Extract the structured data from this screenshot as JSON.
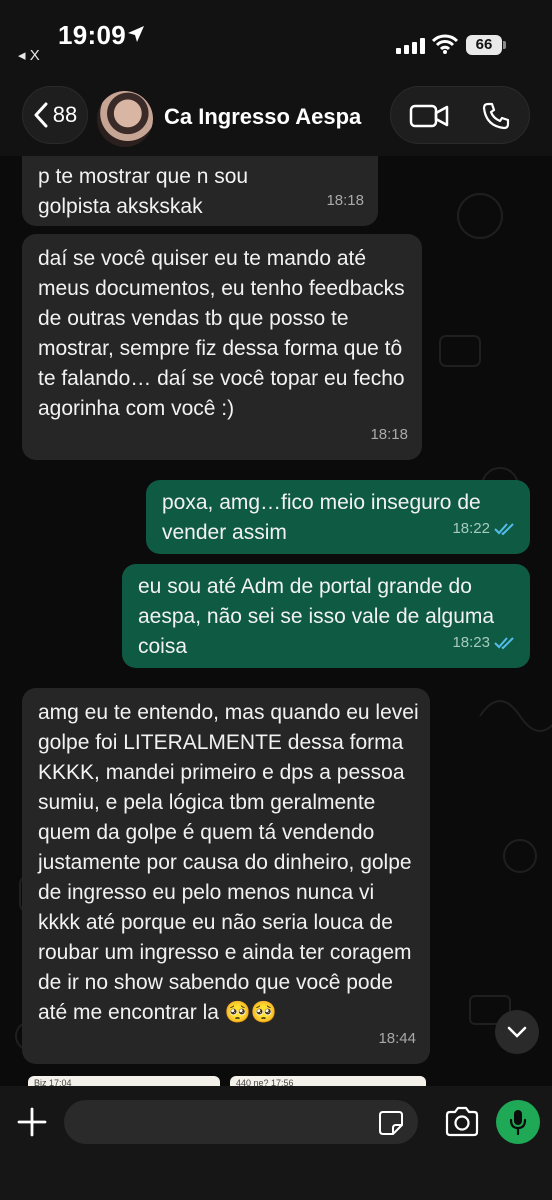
{
  "status_bar": {
    "time": "19:09",
    "back_app": "◂ X",
    "battery": "66"
  },
  "header": {
    "back_count": "88",
    "contact_name": "Ca Ingresso Aespa"
  },
  "messages": [
    {
      "direction": "in",
      "text": "p te mostrar que n sou golpista akskskak",
      "time": "18:18"
    },
    {
      "direction": "in",
      "text": "daí se você quiser eu te mando até meus documentos, eu tenho feedbacks de outras vendas tb que posso te mostrar, sempre fiz dessa forma que tô te falando… daí se você topar eu fecho agorinha com você :)",
      "time": "18:18"
    },
    {
      "direction": "out",
      "text": "poxa, amg…fico meio inseguro de vender assim",
      "time": "18:22"
    },
    {
      "direction": "out",
      "text": "eu sou até Adm de portal grande do aespa, não sei se isso vale de alguma coisa",
      "time": "18:23"
    },
    {
      "direction": "in",
      "text": "amg eu te entendo, mas quando eu levei golpe foi LITERALMENTE dessa forma KKKK, mandei primeiro e dps a pessoa sumiu, e pela lógica tbm geralmente quem da golpe é quem tá vendendo justamente por causa do dinheiro, golpe de ingresso eu pelo menos nunca vi kkkk até porque eu não seria louca de roubar um ingresso e ainda ter coragem de ir no show sabendo que você pode até me encontrar la 🥺🥺",
      "time": "18:44"
    }
  ],
  "previews": [
    {
      "text": "Biz   17:04"
    },
    {
      "text": "440 ne?   17:56"
    }
  ],
  "composer": {
    "placeholder": ""
  },
  "colors": {
    "incoming": "#262626",
    "outgoing": "#0f5a43",
    "mic": "#1fa855",
    "read_ticks": "#53bdeb"
  },
  "icons": [
    "location-arrow-icon",
    "signal-icon",
    "wifi-icon",
    "chevron-left-icon",
    "video-camera-icon",
    "phone-icon",
    "double-check-icon",
    "chevron-down-icon",
    "plus-icon",
    "sticker-icon",
    "camera-icon",
    "microphone-icon"
  ]
}
